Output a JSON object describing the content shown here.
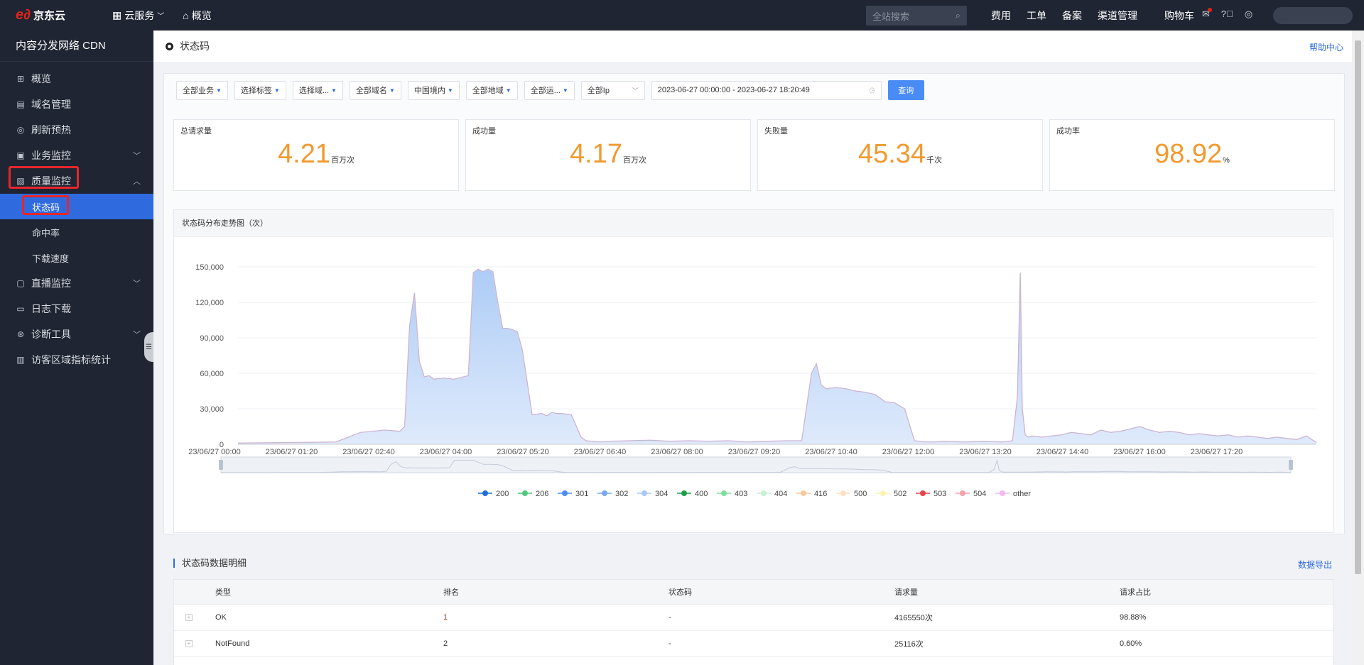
{
  "topbar": {
    "logo_text": "京东云",
    "nav": [
      {
        "label": "云服务"
      },
      {
        "label": "概览"
      }
    ],
    "search_placeholder": "全站搜索",
    "links": [
      "费用",
      "工单",
      "备案",
      "渠道管理"
    ],
    "cart": "购物车"
  },
  "sidebar": {
    "title": "内容分发网络 CDN",
    "items": [
      {
        "label": "概览"
      },
      {
        "label": "域名管理"
      },
      {
        "label": "刷新预热"
      },
      {
        "label": "业务监控"
      },
      {
        "label": "质量监控"
      },
      {
        "label": "状态码"
      },
      {
        "label": "命中率"
      },
      {
        "label": "下载速度"
      },
      {
        "label": "直播监控"
      },
      {
        "label": "日志下载"
      },
      {
        "label": "诊断工具"
      },
      {
        "label": "访客区域指标统计"
      }
    ]
  },
  "page": {
    "title": "状态码",
    "help": "帮助中心"
  },
  "filters": {
    "business": "全部业务",
    "tag": "选择标签",
    "domain_select": "选择域...",
    "all_domains": "全部域名",
    "region": "中国境内",
    "area": "全部地域",
    "isp": "全部运...",
    "ip": "全部Ip",
    "date_range": "2023-06-27 00:00:00 - 2023-06-27 18:20:49",
    "query_button": "查询"
  },
  "cards": [
    {
      "label": "总请求量",
      "value": "4.21",
      "unit": "百万次"
    },
    {
      "label": "成功量",
      "value": "4.17",
      "unit": "百万次"
    },
    {
      "label": "失败量",
      "value": "45.34",
      "unit": "千次"
    },
    {
      "label": "成功率",
      "value": "98.92",
      "unit": "%"
    }
  ],
  "chart_title": "状态码分布走势图（次）",
  "chart_data": {
    "type": "area",
    "title": "状态码分布走势图（次）",
    "ylim": [
      0,
      150000
    ],
    "yticks": [
      "0",
      "30,000",
      "60,000",
      "90,000",
      "120,000",
      "150,000"
    ],
    "xticks": [
      "23/06/27 00:00",
      "23/06/27 01:20",
      "23/06/27 02:40",
      "23/06/27 04:00",
      "23/06/27 05:20",
      "23/06/27 06:40",
      "23/06/27 08:00",
      "23/06/27 09:20",
      "23/06/27 10:40",
      "23/06/27 12:00",
      "23/06/27 13:20",
      "23/06/27 14:40",
      "23/06/27 16:00",
      "23/06/27 17:20"
    ],
    "x_minutes": [
      0,
      60,
      100,
      125,
      150,
      165,
      170,
      175,
      180,
      185,
      190,
      195,
      200,
      210,
      220,
      230,
      235,
      240,
      245,
      250,
      255,
      260,
      265,
      270,
      275,
      280,
      285,
      290,
      300,
      310,
      315,
      320,
      325,
      330,
      340,
      350,
      355,
      360,
      370,
      380,
      400,
      420,
      440,
      460,
      480,
      500,
      520,
      540,
      560,
      575,
      585,
      590,
      595,
      600,
      610,
      620,
      630,
      640,
      650,
      660,
      670,
      680,
      690,
      700,
      710,
      720,
      740,
      760,
      780,
      790,
      795,
      798,
      800,
      803,
      806,
      810,
      820,
      830,
      840,
      850,
      860,
      870,
      880,
      890,
      900,
      910,
      920,
      930,
      940,
      950,
      960,
      970,
      980,
      990,
      1000,
      1010,
      1020,
      1030,
      1040,
      1050,
      1060,
      1070,
      1080,
      1090,
      1100
    ],
    "series": [
      {
        "name": "200",
        "values": [
          1000,
          1500,
          2000,
          10000,
          12000,
          11000,
          15000,
          100000,
          128000,
          70000,
          57000,
          58000,
          55000,
          56000,
          55000,
          57000,
          58000,
          145000,
          148000,
          146000,
          148000,
          146000,
          120000,
          98000,
          98000,
          97000,
          95000,
          80000,
          25000,
          26000,
          24000,
          27000,
          26000,
          26000,
          25000,
          6000,
          3000,
          2500,
          2000,
          2500,
          3000,
          3500,
          2500,
          3000,
          2500,
          3000,
          2000,
          2500,
          3000,
          3000,
          60000,
          68000,
          50000,
          47000,
          48000,
          47000,
          45000,
          44000,
          42000,
          36000,
          35000,
          30000,
          3000,
          2000,
          2000,
          2500,
          2000,
          2500,
          2000,
          3000,
          40000,
          145000,
          30000,
          8000,
          6000,
          7000,
          6000,
          7000,
          8000,
          10000,
          9000,
          8000,
          12000,
          10000,
          11000,
          13000,
          15000,
          12000,
          10000,
          11000,
          10000,
          8000,
          9000,
          8000,
          7000,
          8000,
          6000,
          7000,
          6000,
          5000,
          6000,
          5000,
          4000,
          7000,
          1500
        ],
        "color": "#1f6fd4"
      },
      {
        "name": "other",
        "values": [],
        "color": "#f2b8f0"
      }
    ],
    "legend": [
      "200",
      "206",
      "301",
      "302",
      "304",
      "400",
      "403",
      "404",
      "416",
      "500",
      "502",
      "503",
      "504",
      "other"
    ],
    "legend_colors": [
      "#1f6fd4",
      "#4cc97a",
      "#4a8cf5",
      "#7aa8f0",
      "#a9c9f5",
      "#1f9e4a",
      "#7de09a",
      "#c6f1d3",
      "#f8c79b",
      "#fde0c2",
      "#fdf3b0",
      "#e8434a",
      "#f5a3a8",
      "#f2b8f0"
    ],
    "legend_placement": "bottom"
  },
  "detail": {
    "title": "状态码数据明细",
    "export": "数据导出",
    "columns": [
      "类型",
      "排名",
      "状态码",
      "请求量",
      "请求占比"
    ],
    "rows": [
      {
        "type": "OK",
        "rank": "1",
        "code": "-",
        "count": "4165550次",
        "ratio": "98.88%"
      },
      {
        "type": "NotFound",
        "rank": "2",
        "code": "-",
        "count": "25116次",
        "ratio": "0.60%"
      }
    ]
  }
}
